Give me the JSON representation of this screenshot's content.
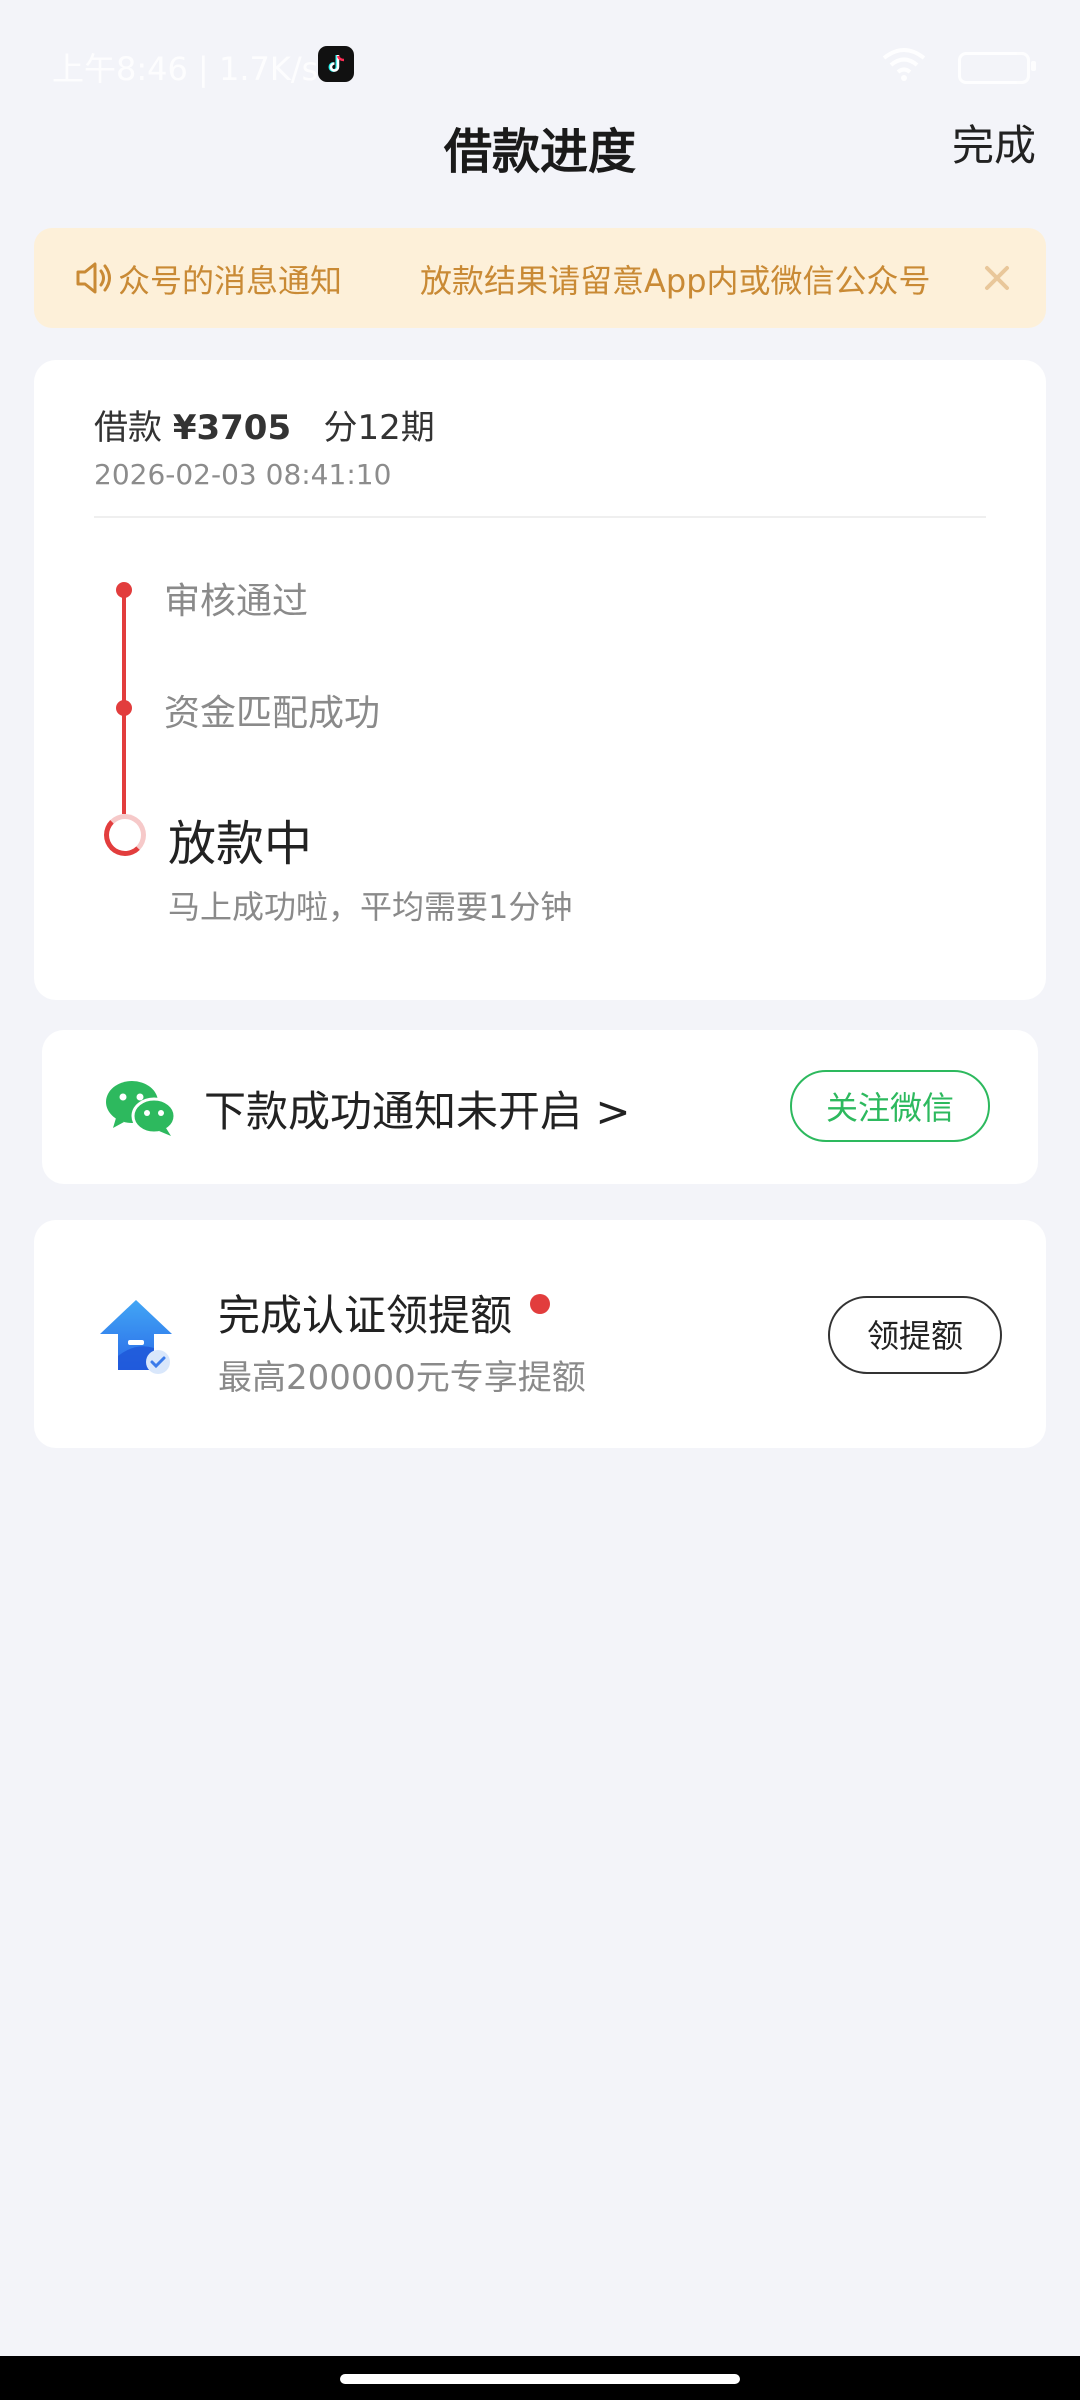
{
  "status_bar": {
    "time_text": "上午8:46 | 1.7K/s",
    "app_icon": "tiktok-icon"
  },
  "header": {
    "title": "借款进度",
    "done_label": "完成"
  },
  "notice": {
    "icon": "speaker-icon",
    "text_part1": "众号的消息通知",
    "text_part2": "放款结果请留意App内或微信公众号",
    "close_icon": "close-icon"
  },
  "loan": {
    "label": "借款",
    "amount": "¥3705",
    "installments": "分12期",
    "datetime": "2026-02-03 08:41:10",
    "steps": [
      {
        "label": "审核通过"
      },
      {
        "label": "资金匹配成功"
      },
      {
        "label": "放款中",
        "sub": "马上成功啦，平均需要1分钟"
      }
    ],
    "accent_color": "#E23D3D"
  },
  "wechat": {
    "icon": "wechat-icon",
    "text": "下款成功通知未开启 >",
    "button_label": "关注微信",
    "brand_color": "#2DB95E"
  },
  "quota": {
    "icon": "quota-up-arrow-icon",
    "title": "完成认证领提额",
    "subtitle": "最高200000元专享提额",
    "button_label": "领提额"
  }
}
